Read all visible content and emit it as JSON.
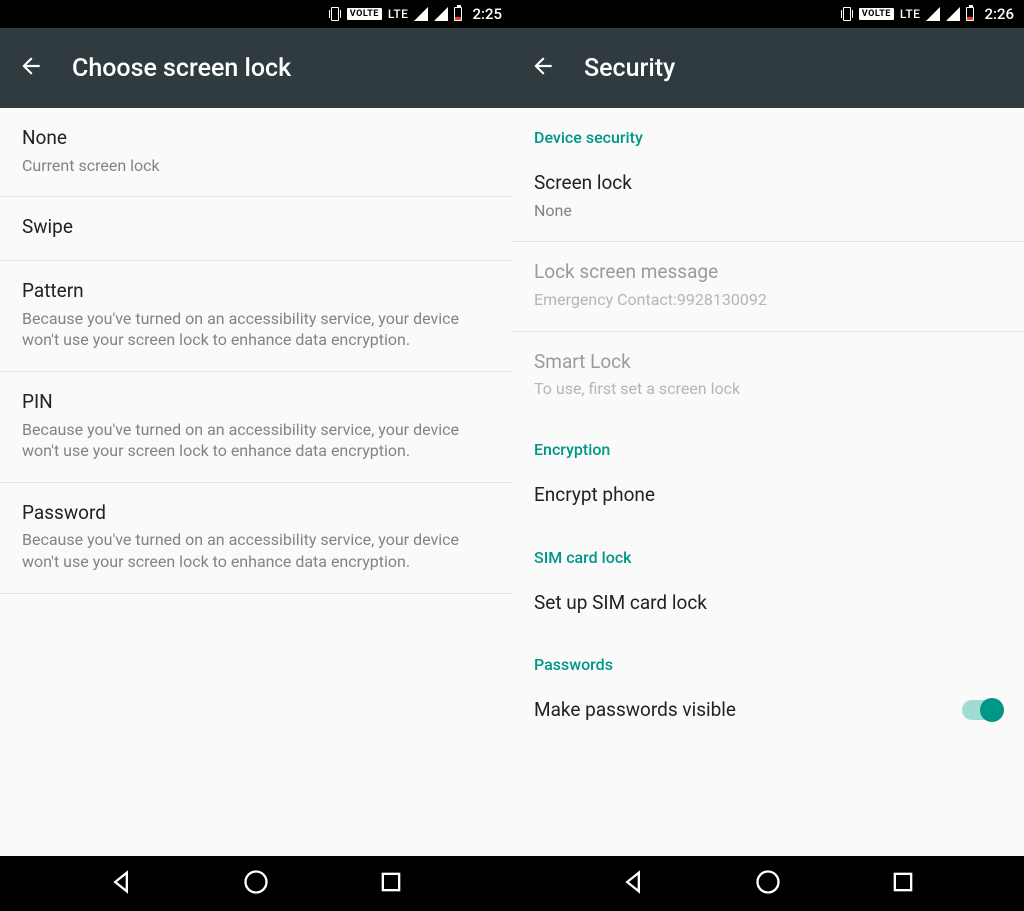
{
  "left": {
    "status": {
      "volte": "VOLTE",
      "net": "LTE",
      "time": "2:25"
    },
    "title": "Choose screen lock",
    "items": [
      {
        "title": "None",
        "subtitle": "Current screen lock"
      },
      {
        "title": "Swipe",
        "subtitle": ""
      },
      {
        "title": "Pattern",
        "subtitle": "Because you've turned on an accessibility service, your device won't use your screen lock to enhance data encryption."
      },
      {
        "title": "PIN",
        "subtitle": "Because you've turned on an accessibility service, your device won't use your screen lock to enhance data encryption."
      },
      {
        "title": "Password",
        "subtitle": "Because you've turned on an accessibility service, your device won't use your screen lock to enhance data encryption."
      }
    ]
  },
  "right": {
    "status": {
      "volte": "VOLTE",
      "net": "LTE",
      "time": "2:26"
    },
    "title": "Security",
    "sections": {
      "device_security": "Device security",
      "encryption": "Encryption",
      "sim_card_lock": "SIM card lock",
      "passwords": "Passwords"
    },
    "items": {
      "screen_lock": {
        "title": "Screen lock",
        "subtitle": "None"
      },
      "lock_screen_message": {
        "title": "Lock screen message",
        "subtitle": "Emergency Contact:9928130092"
      },
      "smart_lock": {
        "title": "Smart Lock",
        "subtitle": "To use, first set a screen lock"
      },
      "encrypt_phone": {
        "title": "Encrypt phone"
      },
      "setup_sim_lock": {
        "title": "Set up SIM card lock"
      },
      "make_passwords_visible": {
        "title": "Make passwords visible"
      }
    }
  }
}
